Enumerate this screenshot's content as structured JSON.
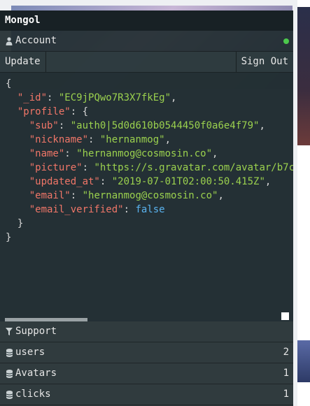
{
  "app": {
    "title": "Mongol"
  },
  "account": {
    "label": "Account",
    "status_color": "#4cc94c"
  },
  "actions": {
    "update_label": "Update",
    "signout_label": "Sign Out"
  },
  "document": {
    "id_key": "\"_id\"",
    "id_value": "\"EC9jPQwo7R3X7fkEg\"",
    "profile_key": "\"profile\"",
    "sub_key": "\"sub\"",
    "sub_value": "\"auth0|5d0d610b0544450f0a6e4f79\"",
    "nickname_key": "\"nickname\"",
    "nickname_value": "\"hernanmog\"",
    "name_key": "\"name\"",
    "name_value": "\"hernanmog@cosmosin.co\"",
    "picture_key": "\"picture\"",
    "picture_value": "\"https://s.gravatar.com/avatar/b7c",
    "updated_at_key": "\"updated_at\"",
    "updated_at_value": "\"2019-07-01T02:00:50.415Z\"",
    "email_key": "\"email\"",
    "email_value": "\"hernanmog@cosmosin.co\"",
    "email_verified_key": "\"email_verified\"",
    "email_verified_value": "false"
  },
  "sections": {
    "support_label": "Support",
    "collections": [
      {
        "name": "users",
        "count": "2"
      },
      {
        "name": "Avatars",
        "count": "1"
      },
      {
        "name": "clicks",
        "count": "1"
      }
    ]
  },
  "icons": {
    "account": "user-icon",
    "support": "funnel-icon",
    "collection": "database-icon"
  }
}
